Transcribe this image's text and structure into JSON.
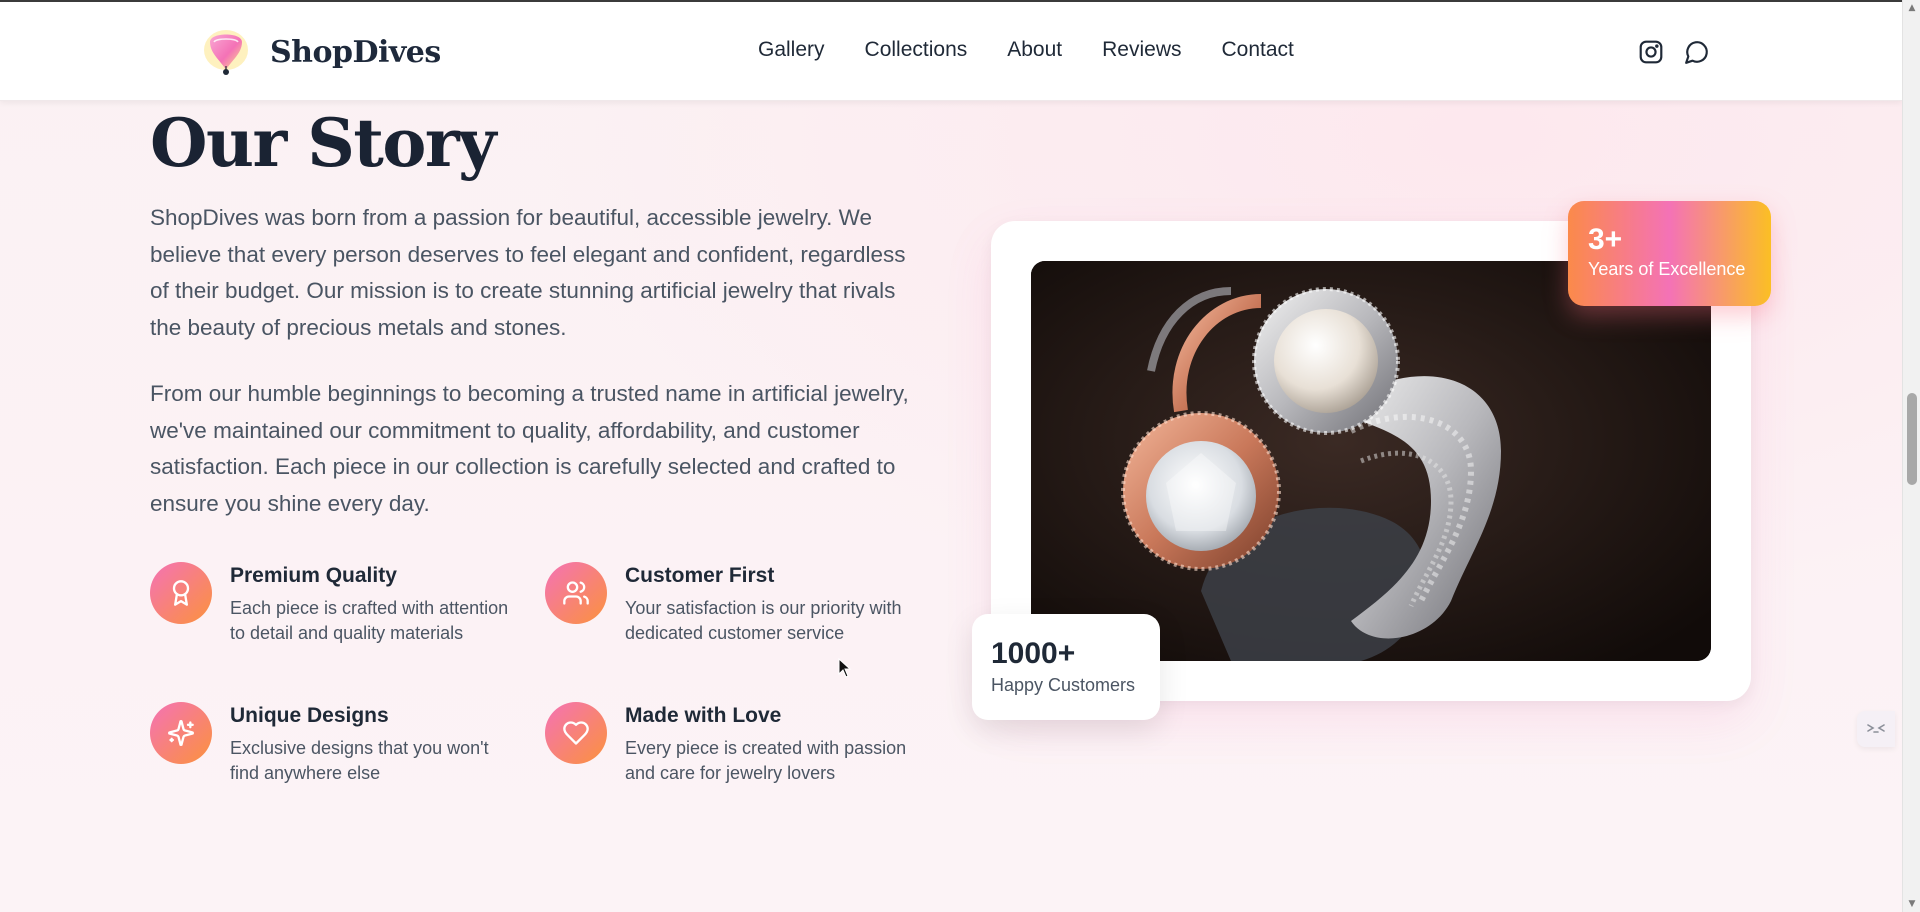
{
  "brand": {
    "name": "ShopDives"
  },
  "nav": {
    "items": [
      "Gallery",
      "Collections",
      "About",
      "Reviews",
      "Contact"
    ]
  },
  "social": {
    "icons": [
      "instagram-icon",
      "chat-bubble-icon"
    ]
  },
  "story": {
    "title": "Our Story",
    "paragraphs": [
      "ShopDives was born from a passion for beautiful, accessible jewelry. We believe that every person deserves to feel elegant and confident, regardless of their budget. Our mission is to create stunning artificial jewelry that rivals the beauty of precious metals and stones.",
      "From our humble beginnings to becoming a trusted name in artificial jewelry, we've maintained our commitment to quality, affordability, and customer satisfaction. Each piece in our collection is carefully selected and crafted to ensure you shine every day."
    ],
    "features": [
      {
        "icon": "award-ribbon-icon",
        "title": "Premium Quality",
        "desc": "Each piece is crafted with attention to detail and quality materials"
      },
      {
        "icon": "users-icon",
        "title": "Customer First",
        "desc": "Your satisfaction is our priority with dedicated customer service"
      },
      {
        "icon": "sparkles-icon",
        "title": "Unique Designs",
        "desc": "Exclusive designs that you won't find anywhere else"
      },
      {
        "icon": "heart-icon",
        "title": "Made with Love",
        "desc": "Every piece is created with passion and care for jewelry lovers"
      }
    ]
  },
  "stats": {
    "years": {
      "value": "3+",
      "label": "Years of Excellence"
    },
    "customers": {
      "value": "1000+",
      "label": "Happy Customers"
    }
  },
  "colors": {
    "accent_pink": "#f472b6",
    "accent_orange": "#fb923c",
    "accent_yellow": "#fbbf24",
    "heading": "#1a2333"
  }
}
